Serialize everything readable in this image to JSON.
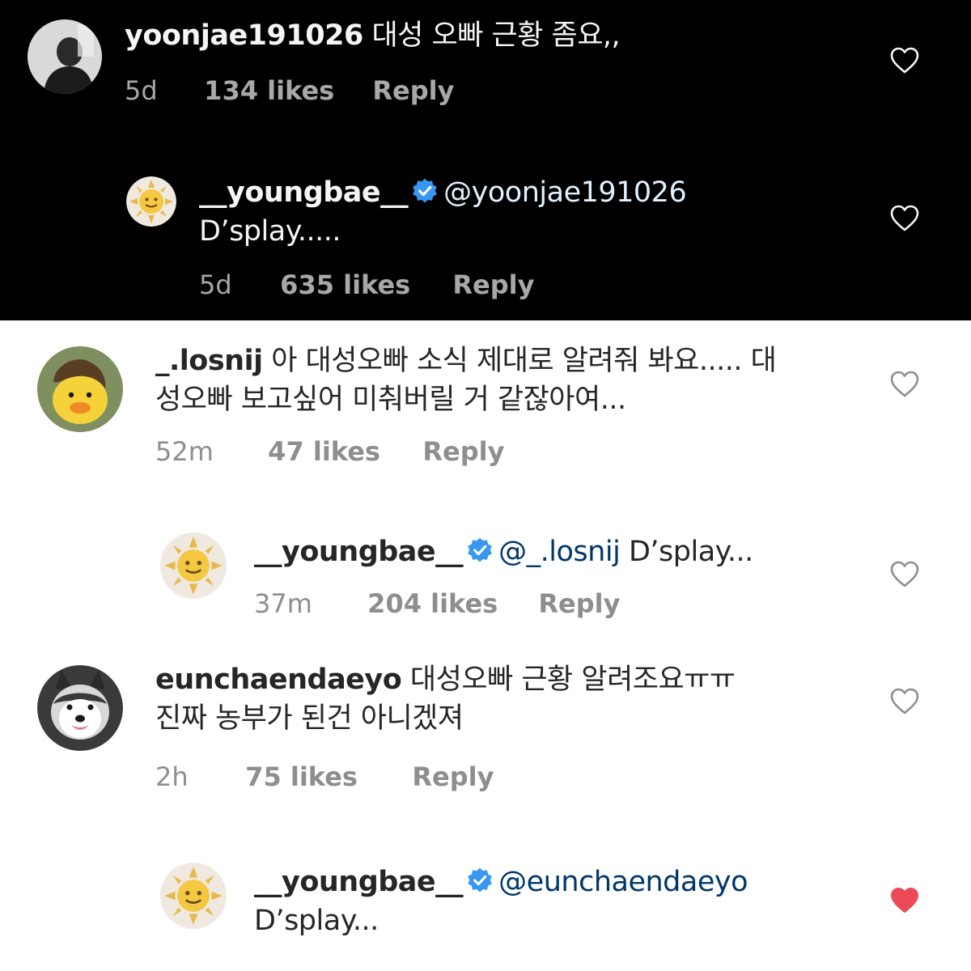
{
  "colors": {
    "dark_bg": "#000000",
    "light_bg": "#ffffff",
    "verified_blue": "#3897f0",
    "liked_red": "#ed4956"
  },
  "comments": [
    {
      "username": "yoonjae191026",
      "mention": "",
      "text": "대성 오빠 근황 좀요,,",
      "time": "5d",
      "likes": "134 likes",
      "reply": "Reply",
      "verified": false,
      "liked": false,
      "avatar_icon": "person-silhouette-avatar",
      "heart_icon": "heart-outline-icon"
    },
    {
      "username": "__youngbae__",
      "mention": "@yoonjae191026",
      "text": "D’splay.....",
      "time": "5d",
      "likes": "635 likes",
      "reply": "Reply",
      "verified": true,
      "liked": false,
      "avatar_icon": "sun-face-avatar",
      "heart_icon": "heart-outline-icon"
    },
    {
      "username": "_.losnij",
      "mention": "",
      "text_line1": "아 대성오빠 소식 제대로 알려줘 봐요..... 대",
      "text_line2": "성오빠 보고싶어 미춰버릴 거 같잖아여...",
      "time": "52m",
      "likes": "47 likes",
      "reply": "Reply",
      "verified": false,
      "liked": false,
      "avatar_icon": "duck-avatar",
      "heart_icon": "heart-outline-icon"
    },
    {
      "username": "__youngbae__",
      "mention": "@_.losnij",
      "text": "D’splay...",
      "time": "37m",
      "likes": "204 likes",
      "reply": "Reply",
      "verified": true,
      "liked": false,
      "avatar_icon": "sun-face-avatar",
      "heart_icon": "heart-outline-icon"
    },
    {
      "username": "eunchaendaeyo",
      "mention": "",
      "text_line1": "대성오빠 근황 알려조요ㅠㅠ",
      "text_line2": "진짜 농부가 된건 아니겠져",
      "time": "2h",
      "likes": "75 likes",
      "reply": "Reply",
      "verified": false,
      "liked": false,
      "avatar_icon": "husky-dog-avatar",
      "heart_icon": "heart-outline-icon"
    },
    {
      "username": "__youngbae__",
      "mention": "@eunchaendaeyo",
      "text": "D’splay...",
      "verified": true,
      "liked": true,
      "avatar_icon": "sun-face-avatar",
      "heart_icon": "heart-filled-icon"
    }
  ]
}
